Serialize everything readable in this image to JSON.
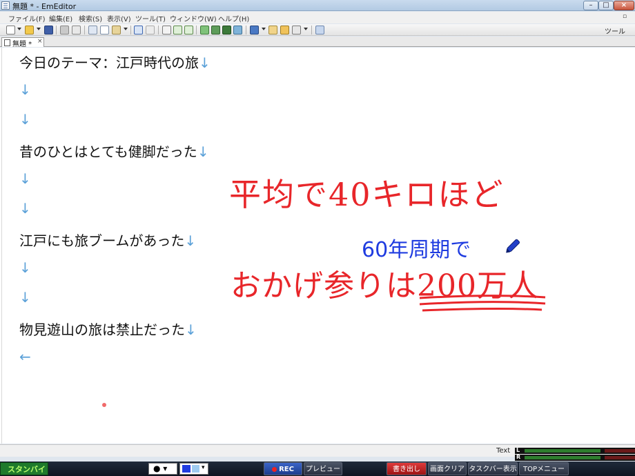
{
  "window": {
    "title": "無題 * - EmEditor",
    "controls": {
      "minimize": "–",
      "maximize": "□",
      "close": "×"
    }
  },
  "menu": [
    "ファイル(F)",
    "編集(E)",
    "検索(S)",
    "表示(V)",
    "ツール(T)",
    "ウィンドウ(W)",
    "ヘルプ(H)"
  ],
  "toolbar": {
    "tools_label": "ツール"
  },
  "tab": {
    "label": "無題 *",
    "close": "×"
  },
  "document": {
    "lines": [
      "今日のテーマ：江戸時代の旅",
      "",
      "",
      "昔のひとはとても健脚だった",
      "",
      "",
      "江戸にも旅ブームがあった",
      "",
      "",
      "物見遊山の旅は禁止だった",
      ""
    ],
    "newline_mark": "↓",
    "eof_mark": "←"
  },
  "annotations": {
    "red_line_1": "平均で40キロほど",
    "blue_line": "60年周期で",
    "red_line_2": "おかげ参りは200万人",
    "red_color": "#e8262a",
    "blue_color": "#1f3ce0"
  },
  "statusbar": {
    "mode": "Text",
    "meter_left_label": "L",
    "meter_right_label": "R"
  },
  "capture_bar": {
    "status": "スタンバイ",
    "pen_color_symbol": "●",
    "rec": "REC",
    "preview": "プレビュー",
    "export": "書き出し",
    "clear_screen": "画面クリア",
    "taskbar_show": "タスクバー表示",
    "top_menu": "TOPメニュー"
  }
}
